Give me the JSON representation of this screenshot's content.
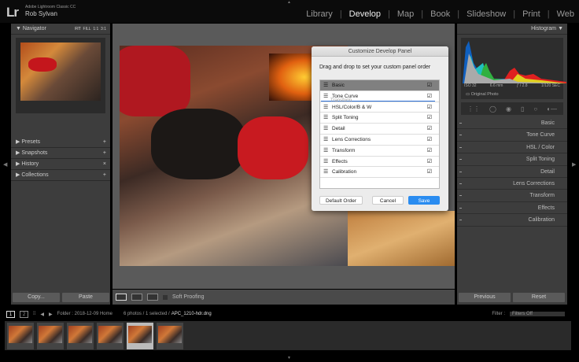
{
  "app": {
    "logo": "Lr",
    "subtitle": "Adobe Lightroom Classic CC",
    "user": "Rob Sylvan"
  },
  "modules": [
    "Library",
    "Develop",
    "Map",
    "Book",
    "Slideshow",
    "Print",
    "Web"
  ],
  "active_module": "Develop",
  "left_panel": {
    "navigator": {
      "title": "Navigator",
      "zoom_options": [
        "FIT",
        "FILL",
        "1:1",
        "3:1"
      ]
    },
    "sections": [
      "Presets",
      "Snapshots",
      "History",
      "Collections"
    ],
    "copy": "Copy...",
    "paste": "Paste"
  },
  "dialog": {
    "title": "Customize Develop Panel",
    "instruction": "Drag and drop to set your custom panel order",
    "items": [
      {
        "label": "Basic",
        "checked": true,
        "selected": true
      },
      {
        "label": "Tone Curve",
        "checked": true
      },
      {
        "label": "HSL/Color/B & W",
        "checked": true
      },
      {
        "label": "Split Toning",
        "checked": true
      },
      {
        "label": "Detail",
        "checked": true
      },
      {
        "label": "Lens Corrections",
        "checked": true
      },
      {
        "label": "Transform",
        "checked": true
      },
      {
        "label": "Effects",
        "checked": true
      },
      {
        "label": "Calibration",
        "checked": true
      }
    ],
    "dragging": "Transform",
    "default_order": "Default Order",
    "cancel": "Cancel",
    "save": "Save",
    "save_color": "#2a8cf0"
  },
  "right_panel": {
    "histogram_title": "Histogram",
    "iso": "ISO 32",
    "focal": "6.6 mm",
    "aperture": "ƒ / 2.8",
    "shutter": "1/120 SEC",
    "original_photo": "Original Photo",
    "panels": [
      "Basic",
      "Tone Curve",
      "HSL / Color",
      "Split Toning",
      "Detail",
      "Lens Corrections",
      "Transform",
      "Effects",
      "Calibration"
    ],
    "previous": "Previous",
    "reset": "Reset"
  },
  "toolbar": {
    "soft_proofing": "Soft Proofing"
  },
  "filmstrip": {
    "page1": "1",
    "page2": "2",
    "folder": "Folder : 2018-12-09 Home",
    "count": "6 photos / 1 selected /",
    "filename": "APC_1210-hdr.dng",
    "filter_label": "Filter :",
    "filter_value": "Filters Off",
    "thumbnail_count": 6,
    "selected_index": 4
  }
}
